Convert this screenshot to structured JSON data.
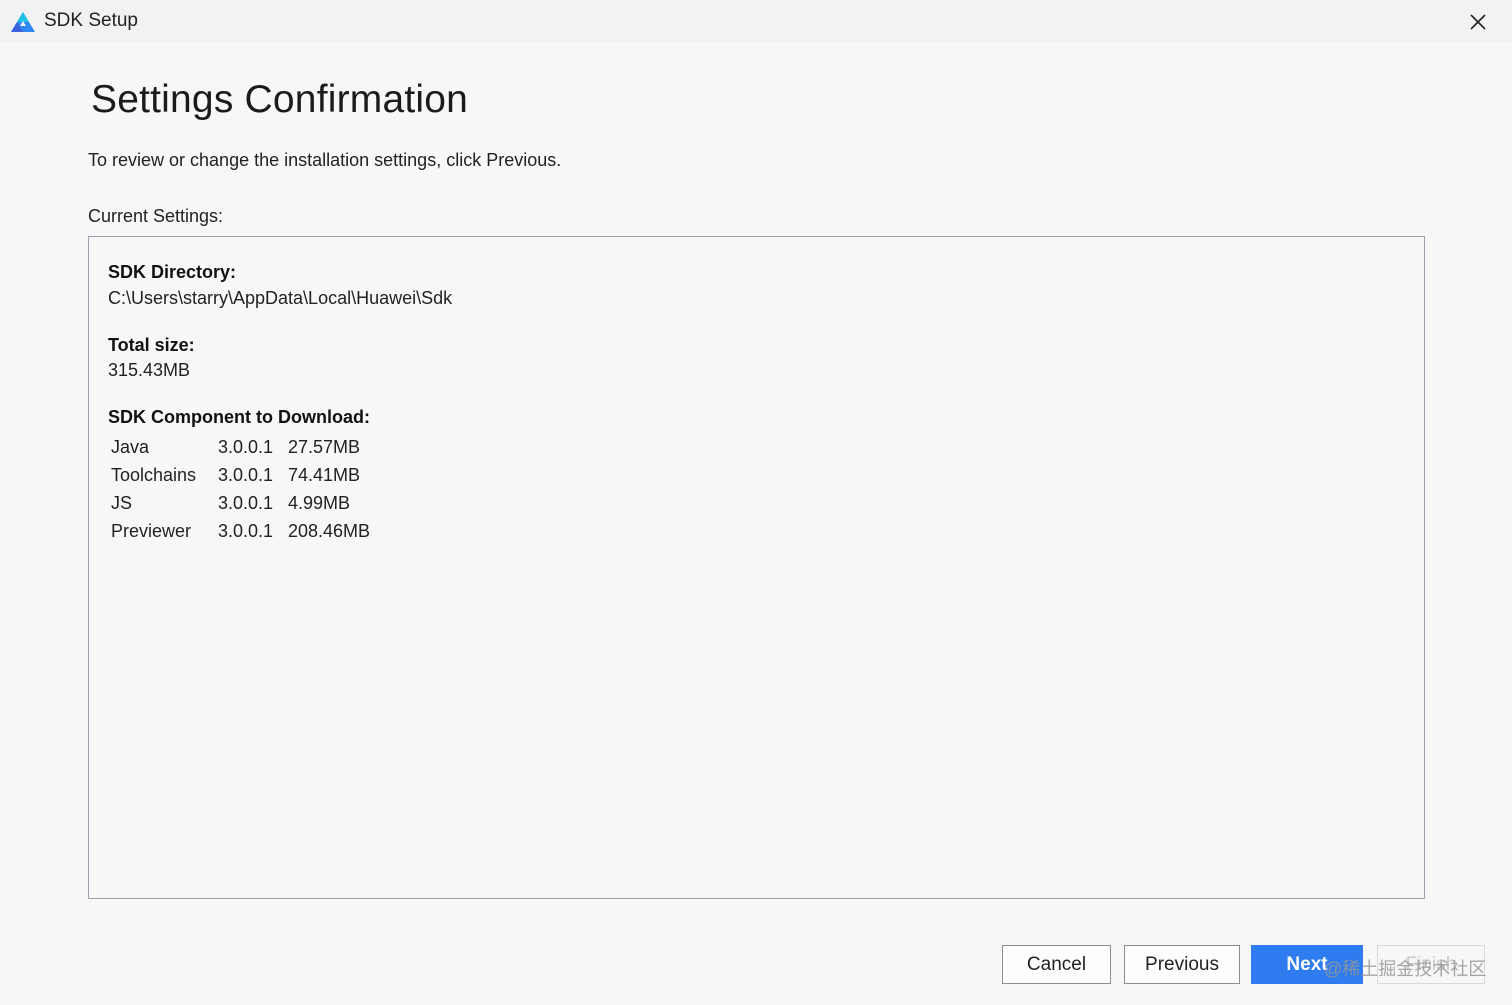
{
  "window": {
    "title": "SDK Setup",
    "app_icon": "huawei-deveco-triangle-icon",
    "close_icon": "close-icon"
  },
  "page": {
    "title": "Settings Confirmation",
    "subtitle": "To review or change the installation settings, click Previous.",
    "current_settings_label": "Current Settings:"
  },
  "settings": {
    "sdk_directory_label": "SDK Directory:",
    "sdk_directory_value": "C:\\Users\\starry\\AppData\\Local\\Huawei\\Sdk",
    "total_size_label": "Total size:",
    "total_size_value": "315.43MB",
    "components_label": "SDK Component to Download:",
    "components": [
      {
        "name": "Java",
        "version": "3.0.0.1",
        "size": "27.57MB"
      },
      {
        "name": "Toolchains",
        "version": "3.0.0.1",
        "size": "74.41MB"
      },
      {
        "name": "JS",
        "version": "3.0.0.1",
        "size": "4.99MB"
      },
      {
        "name": "Previewer",
        "version": "3.0.0.1",
        "size": "208.46MB"
      }
    ]
  },
  "buttons": {
    "cancel": "Cancel",
    "previous": "Previous",
    "next": "Next",
    "finish": "Finish"
  },
  "watermark": "@稀土掘金技术社区",
  "colors": {
    "primary": "#2e7cf0",
    "background": "#f7f7f7",
    "box_border": "#9aa3ad"
  }
}
